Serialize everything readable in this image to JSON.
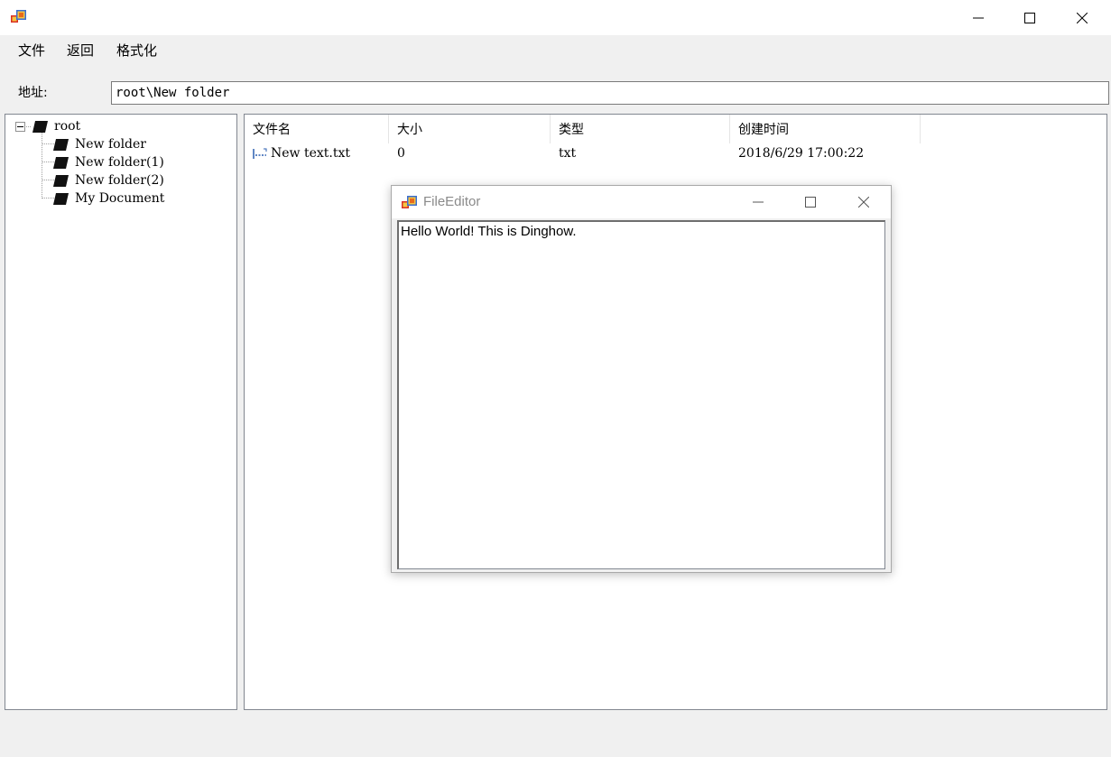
{
  "window": {
    "app_icon": "app-icon"
  },
  "menu": {
    "items": [
      "文件",
      "返回",
      "格式化"
    ]
  },
  "address": {
    "label": "地址:",
    "value": "root\\New folder"
  },
  "tree": {
    "root": "root",
    "children": [
      "New folder",
      "New folder(1)",
      "New folder(2)",
      "My Document"
    ]
  },
  "list": {
    "columns": [
      "文件名",
      "大小",
      "类型",
      "创建时间"
    ],
    "rows": [
      {
        "name": "New text.txt",
        "size": "0",
        "type": "txt",
        "created": "2018/6/29 17:00:22"
      }
    ]
  },
  "editor": {
    "title": "FileEditor",
    "content": "Hello World! This is Dinghow."
  }
}
